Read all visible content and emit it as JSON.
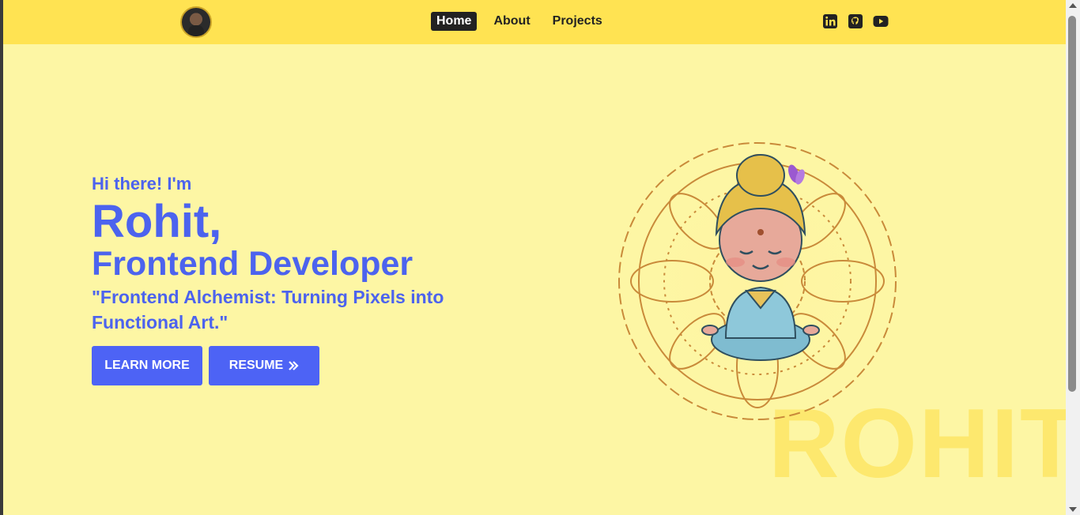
{
  "nav": {
    "links": [
      {
        "label": "Home",
        "active": true
      },
      {
        "label": "About",
        "active": false
      },
      {
        "label": "Projects",
        "active": false
      }
    ],
    "social_icons": [
      "linkedin-icon",
      "github-icon",
      "youtube-icon"
    ]
  },
  "hero": {
    "greeting": "Hi there! I'm",
    "name": "Rohit,",
    "role": "Frontend Developer",
    "tagline": "\"Frontend Alchemist: Turning Pixels into Functional Art.\"",
    "learn_more_label": "LEARN MORE",
    "resume_label": "RESUME",
    "watermark": "ROHIT"
  },
  "colors": {
    "navbar": "#ffe352",
    "background": "#fdf6a4",
    "accent": "#4d63f5",
    "text_accent": "#4c63ee"
  }
}
